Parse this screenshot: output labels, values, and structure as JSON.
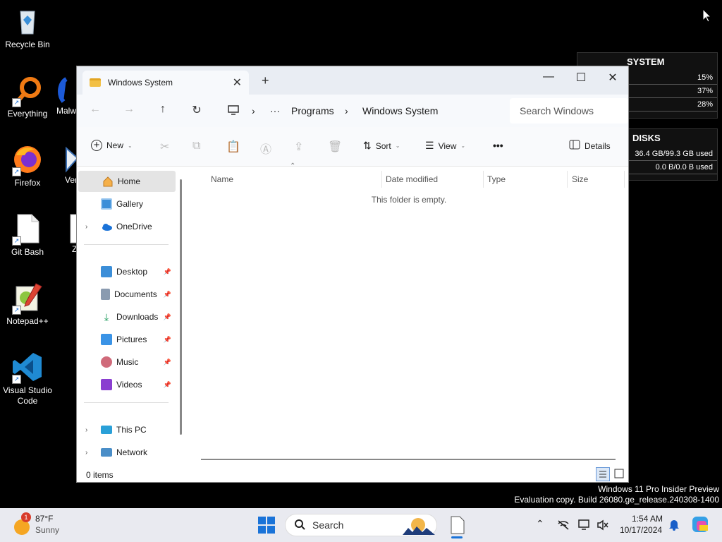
{
  "desktop": {
    "icons": [
      {
        "label": "Recycle Bin"
      },
      {
        "label": "Everything"
      },
      {
        "label": "Malw"
      },
      {
        "label": "Firefox"
      },
      {
        "label": "Ver"
      },
      {
        "label": "Git Bash"
      },
      {
        "label": "Z"
      },
      {
        "label": "Notepad++"
      },
      {
        "label": "Visual Studio Code"
      }
    ]
  },
  "widget": {
    "system_title": "SYSTEM",
    "system_rows": [
      "15%",
      "37%",
      "28%"
    ],
    "disks_title": "DISKS",
    "disks_rows": [
      "36.4 GB/99.3 GB used",
      "0.0 B/0.0 B used"
    ]
  },
  "explorer": {
    "tab_title": "Windows System",
    "breadcrumb": [
      "Programs",
      "Windows System"
    ],
    "search_placeholder": "Search Windows System",
    "toolbar": {
      "new": "New",
      "sort": "Sort",
      "view": "View",
      "more": "•••",
      "details": "Details"
    },
    "sidebar": {
      "top": [
        "Home",
        "Gallery",
        "OneDrive"
      ],
      "pinned": [
        "Desktop",
        "Documents",
        "Downloads",
        "Pictures",
        "Music",
        "Videos"
      ],
      "devices": [
        "This PC",
        "Network"
      ]
    },
    "columns": [
      "Name",
      "Date modified",
      "Type",
      "Size"
    ],
    "empty_message": "This folder is empty.",
    "status": "0 items"
  },
  "watermark": {
    "line1": "Windows 11 Pro Insider Preview",
    "line2": "Evaluation copy. Build 26080.ge_release.240308-1400"
  },
  "taskbar": {
    "weather_temp": "87°F",
    "weather_desc": "Sunny",
    "weather_badge": "1",
    "search_label": "Search",
    "time": "1:54 AM",
    "date": "10/17/2024"
  }
}
